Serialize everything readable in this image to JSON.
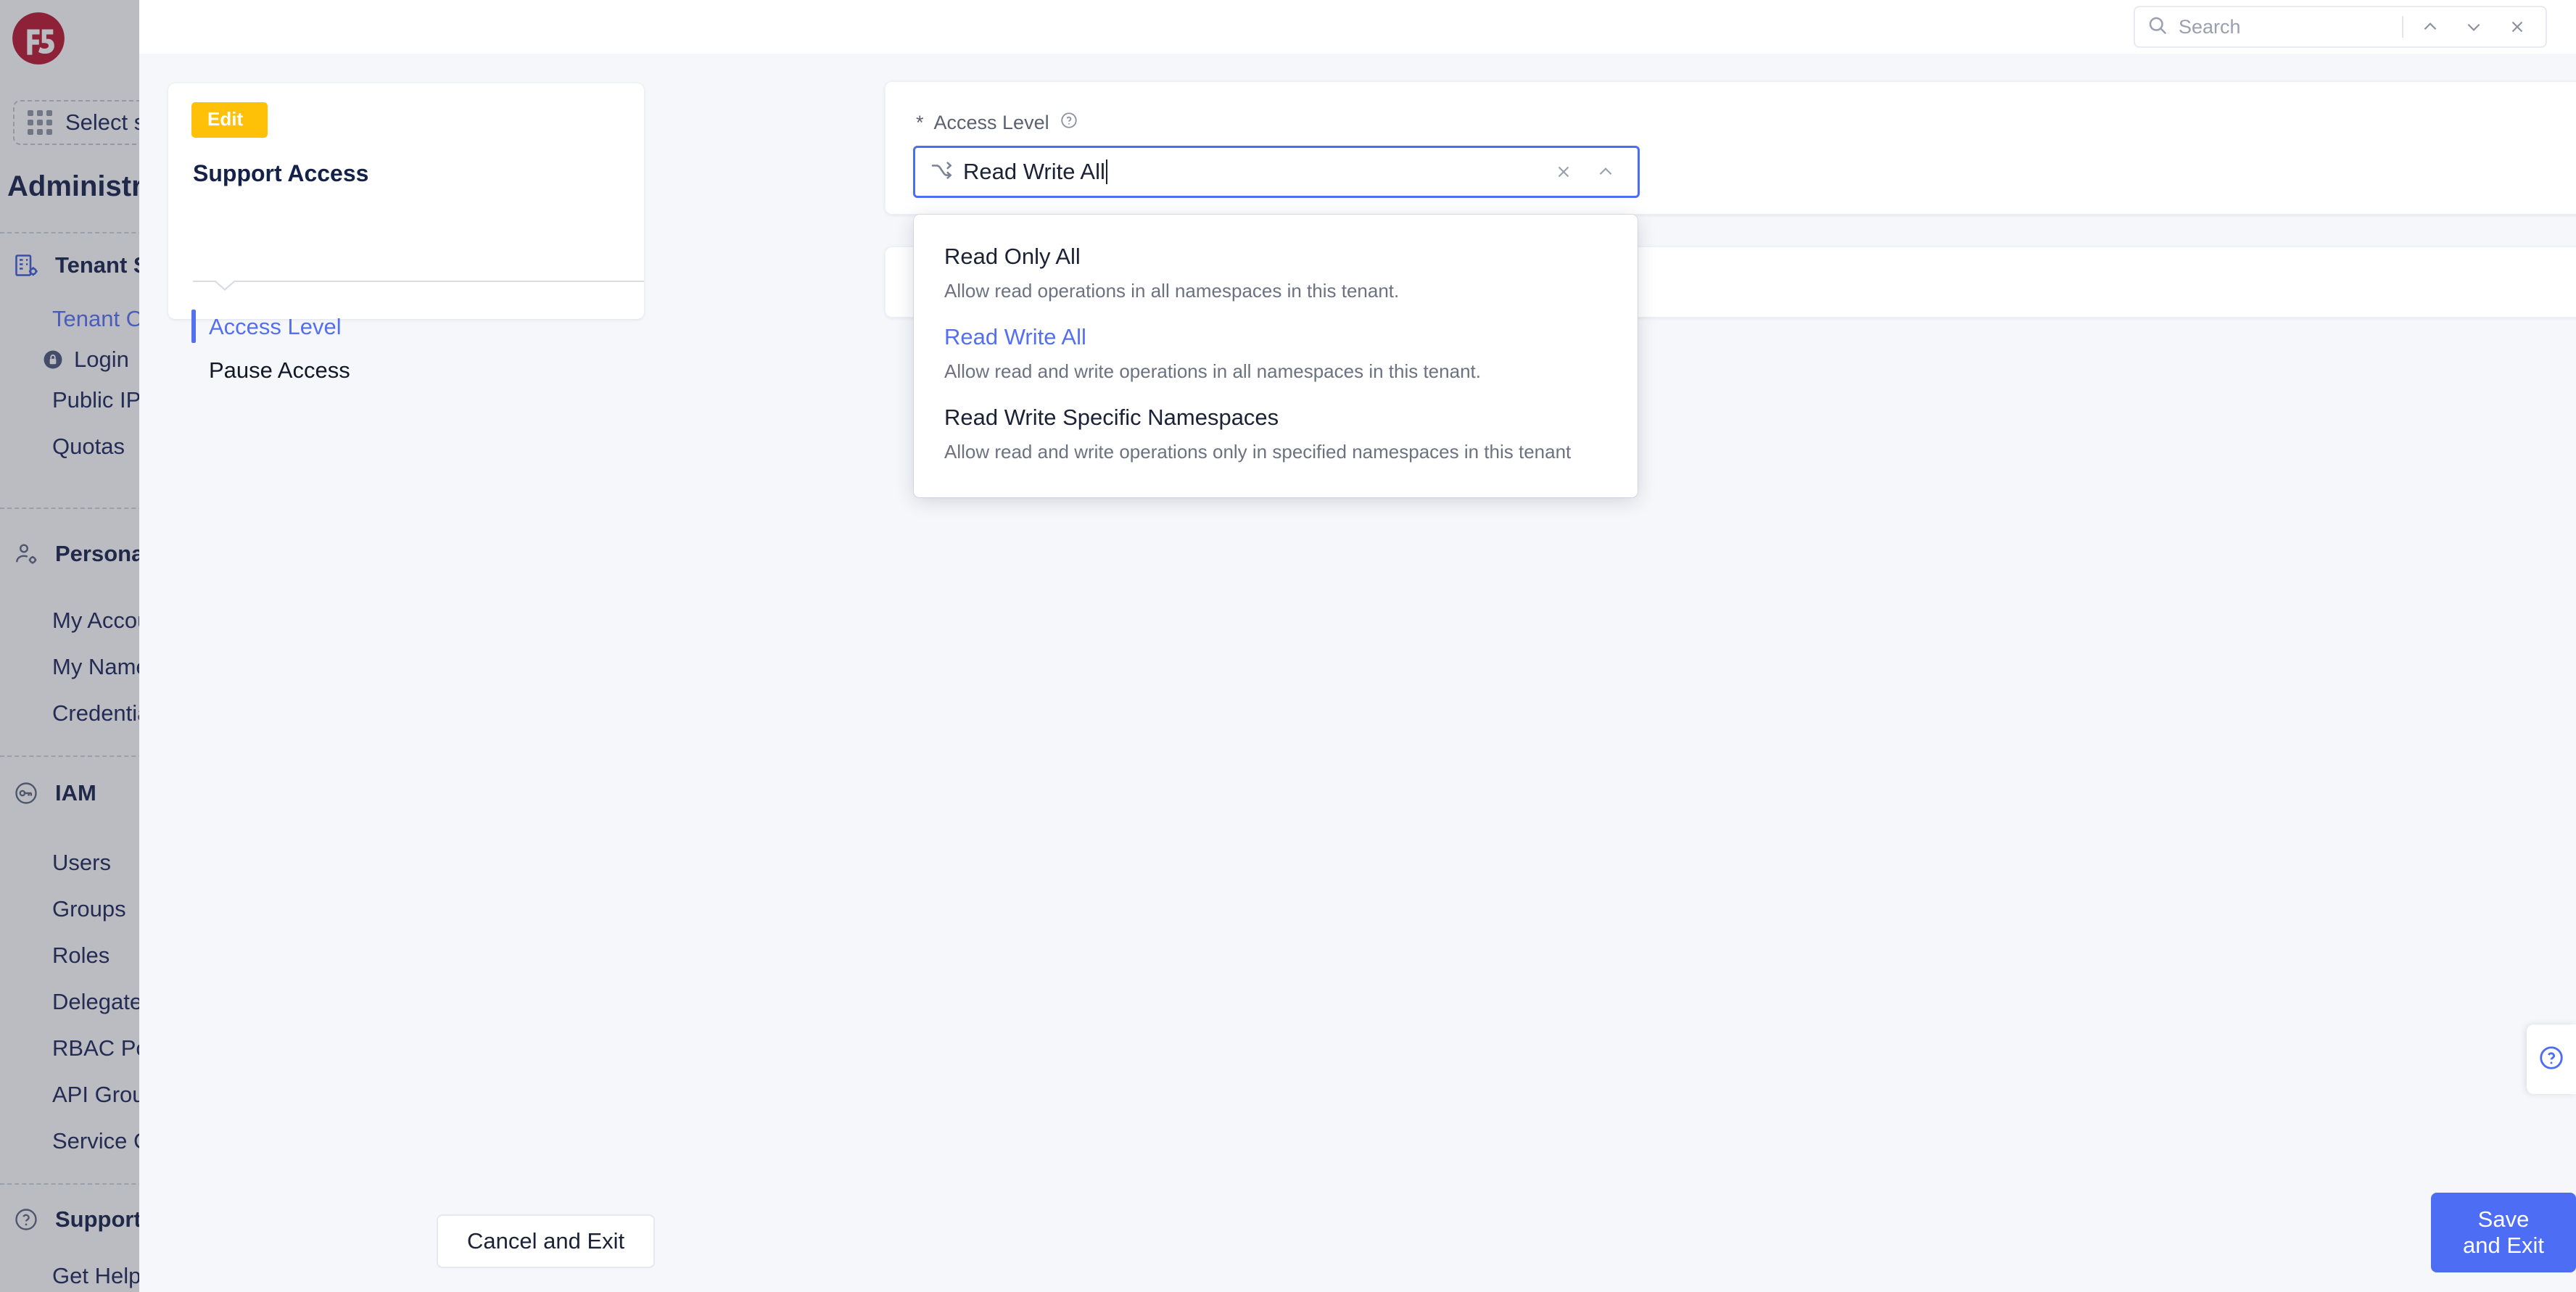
{
  "brand": {
    "logo_alt": "f5",
    "accent_blue": "#4d6df5",
    "accent_yellow": "#ffc107",
    "logo_red": "#b8142e"
  },
  "app_sidebar": {
    "tenant_selector": {
      "label": "Select se",
      "icon": "grid-dots-icon"
    },
    "page_title": "Administra",
    "groups": [
      {
        "title": "Tenant S",
        "icon": "tenant-settings-icon",
        "items": [
          {
            "label": "Tenant Ov",
            "style": "link"
          },
          {
            "label": "Login",
            "style": "normal",
            "icon": "lock-icon"
          },
          {
            "label": "Public IP",
            "style": "normal"
          },
          {
            "label": "Quotas",
            "style": "normal"
          }
        ]
      },
      {
        "title": "Persona",
        "icon": "person-settings-icon",
        "items": [
          {
            "label": "My Accou",
            "style": "normal"
          },
          {
            "label": "My Name",
            "style": "normal"
          },
          {
            "label": "Credentia",
            "style": "normal"
          }
        ]
      },
      {
        "title": "IAM",
        "icon": "key-icon",
        "items": [
          {
            "label": "Users",
            "style": "normal"
          },
          {
            "label": "Groups",
            "style": "normal"
          },
          {
            "label": "Roles",
            "style": "normal"
          },
          {
            "label": "Delegated",
            "style": "normal"
          },
          {
            "label": "RBAC Pol",
            "style": "normal"
          },
          {
            "label": "API Group",
            "style": "normal"
          },
          {
            "label": "Service C",
            "style": "normal"
          }
        ]
      },
      {
        "title": "Support",
        "icon": "question-circle-icon",
        "items": [
          {
            "label": "Get Help",
            "style": "normal"
          }
        ]
      }
    ]
  },
  "find_bar": {
    "placeholder": "Search",
    "value": "",
    "search_icon": "search-icon",
    "prev_icon": "chevron-up-icon",
    "next_icon": "chevron-down-icon",
    "close_icon": "close-icon"
  },
  "wizard": {
    "badge": "Edit",
    "title": "Support Access",
    "steps": [
      {
        "label": "Access Level",
        "active": true
      },
      {
        "label": "Pause Access",
        "active": false
      }
    ]
  },
  "form": {
    "field": {
      "label": "Access Level",
      "required_marker": "*",
      "help_icon": "help-circle-icon",
      "leading_icon": "shuffle-arrows-icon",
      "value": "Read Write All",
      "clear_icon": "close-icon",
      "toggle_icon": "chevron-up-icon"
    },
    "dropdown": {
      "options": [
        {
          "title": "Read Only All",
          "description": "Allow read operations in all namespaces in this tenant.",
          "selected": false
        },
        {
          "title": "Read Write All",
          "description": "Allow read and write operations in all namespaces in this tenant.",
          "selected": true
        },
        {
          "title": "Read Write Specific Namespaces",
          "description": "Allow read and write operations only in specified namespaces in this tenant",
          "selected": false
        }
      ]
    }
  },
  "footer": {
    "cancel_label": "Cancel and Exit",
    "save_label": "Save and Exit"
  },
  "help_tab": {
    "icon": "help-circle-icon"
  }
}
